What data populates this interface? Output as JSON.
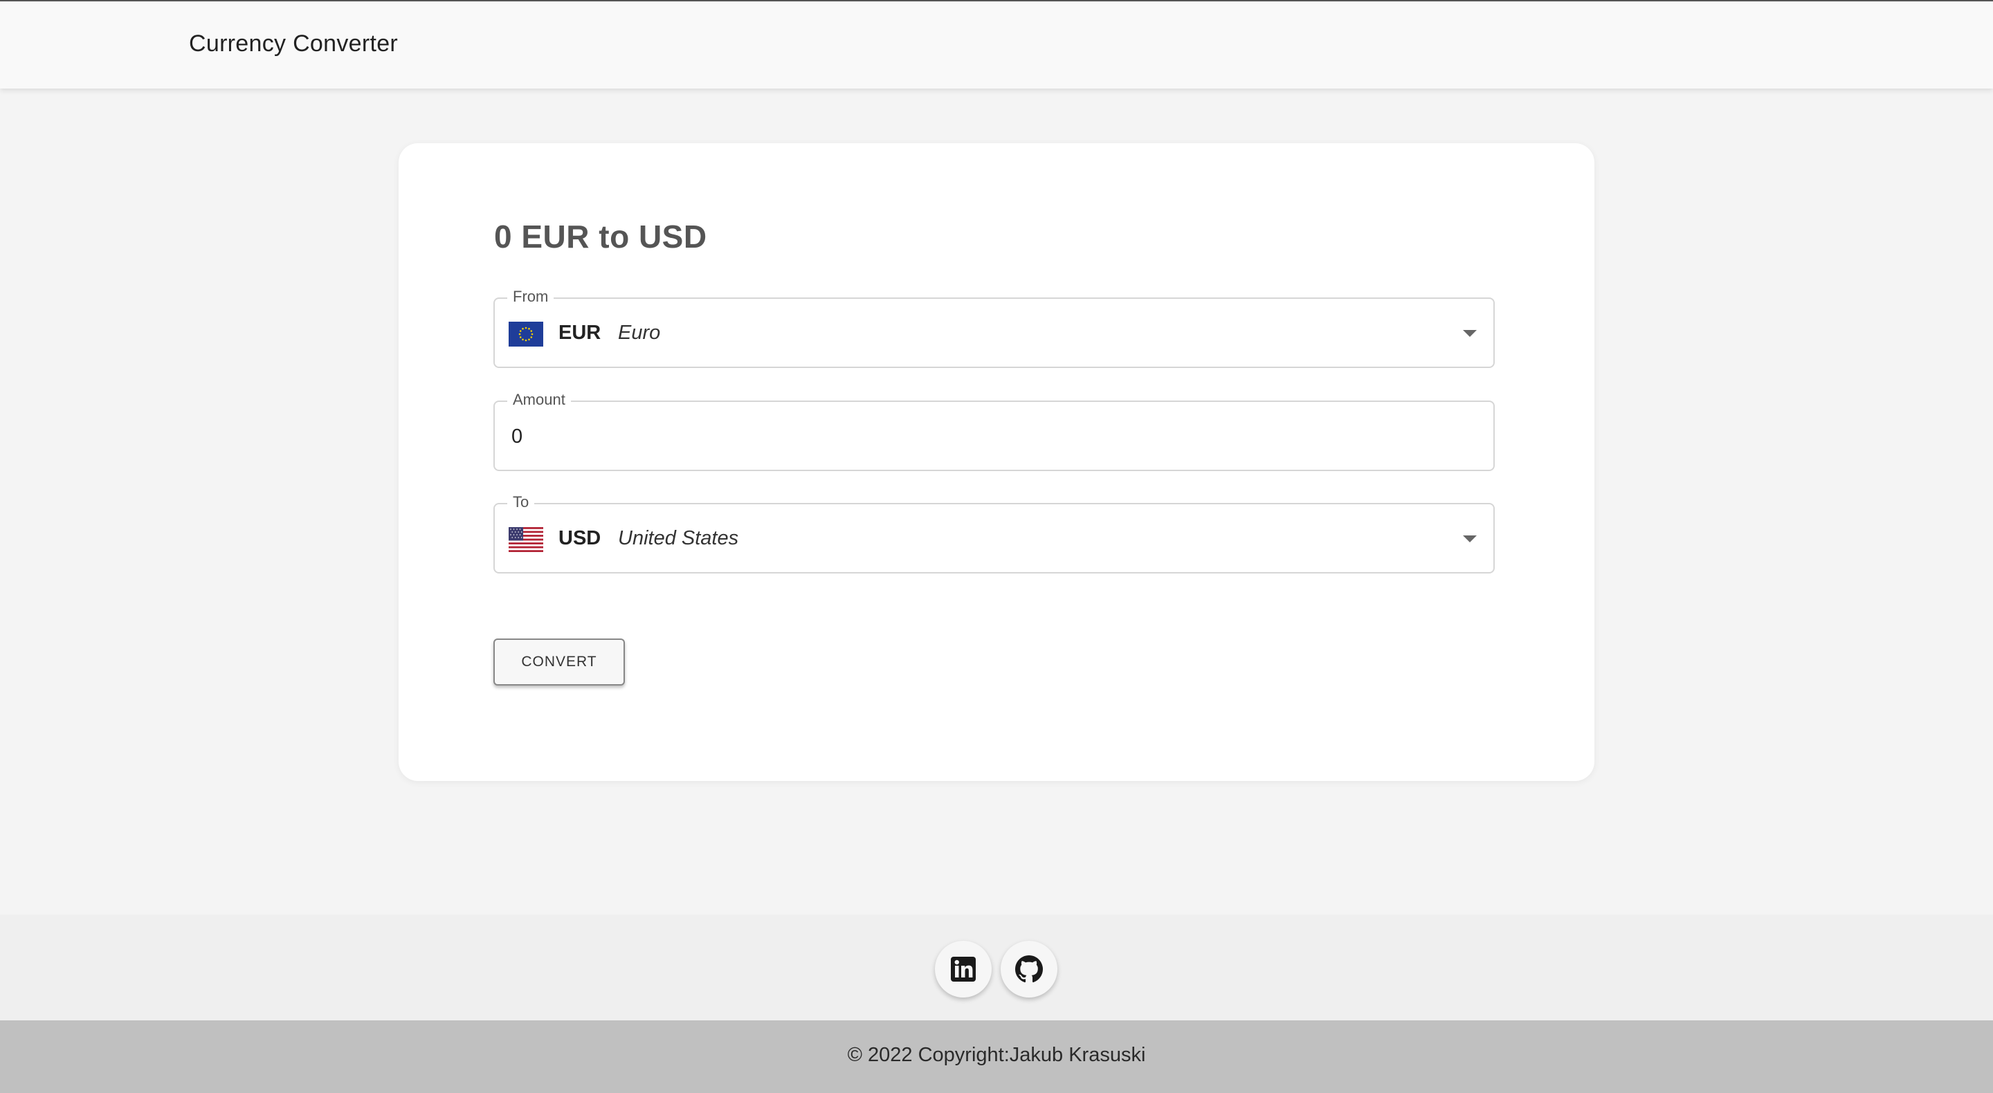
{
  "header": {
    "title": "Currency Converter"
  },
  "converter": {
    "heading": "0 EUR to USD",
    "from": {
      "label": "From",
      "code": "EUR",
      "name": "Euro",
      "flag_icon": "eu-flag-icon"
    },
    "amount": {
      "label": "Amount",
      "value": "0"
    },
    "to": {
      "label": "To",
      "code": "USD",
      "name": "United States",
      "flag_icon": "us-flag-icon"
    },
    "convert_label": "CONVERT"
  },
  "footer": {
    "social": [
      {
        "name": "linkedin",
        "icon": "linkedin-icon"
      },
      {
        "name": "github",
        "icon": "github-icon"
      }
    ],
    "copyright": "© 2022 Copyright:Jakub Krasuski"
  },
  "colors": {
    "page_background": "#f4f4f4",
    "card_background": "#ffffff",
    "footer_social_background": "#efefef",
    "footer_copyright_background": "#c0c0c0"
  }
}
